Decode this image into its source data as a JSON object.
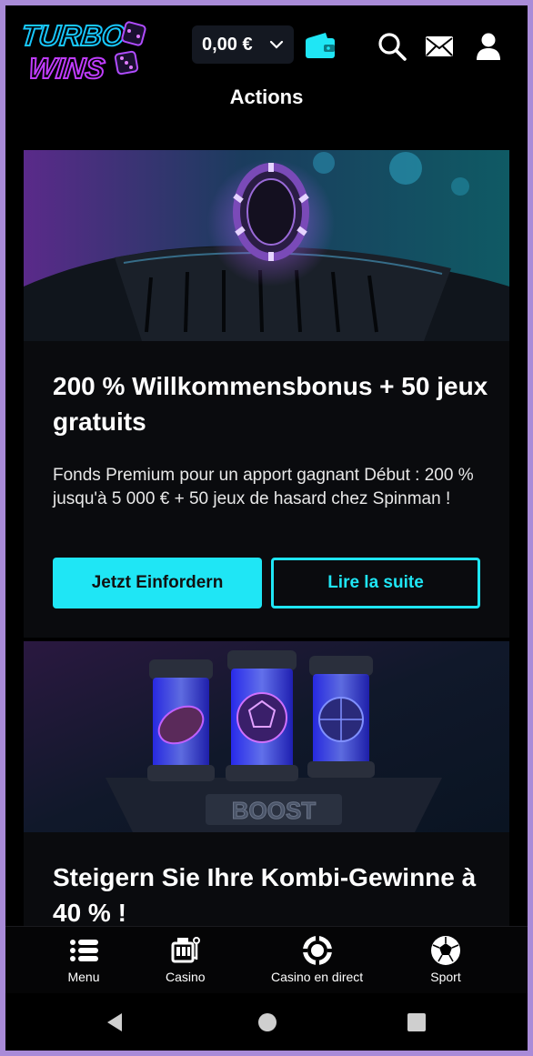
{
  "header": {
    "logo_line1": "TURBO",
    "logo_line2": "WINS",
    "balance": "0,00 €",
    "page_title": "Actions"
  },
  "promotions": [
    {
      "title": "200 % Willkommensbonus + 50 jeux gratuits",
      "description": "Fonds Premium pour un apport gagnant Début : 200 % jusqu'à 5 000 € + 50 jeux de hasard chez Spinman !",
      "primary_button": "Jetzt Einfordern",
      "secondary_button": "Lire la suite"
    },
    {
      "title": "Steigern Sie Ihre Kombi-Gewinne à 40 % !",
      "image_text": "BOOST"
    }
  ],
  "bottom_nav": [
    {
      "label": "Menu",
      "icon": "menu-icon"
    },
    {
      "label": "Casino",
      "icon": "slot-machine-icon"
    },
    {
      "label": "Casino en direct",
      "icon": "chip-icon"
    },
    {
      "label": "Sport",
      "icon": "soccer-ball-icon"
    }
  ],
  "colors": {
    "accent": "#1fe6f5",
    "background": "#000000",
    "frame": "#a98bd8"
  }
}
